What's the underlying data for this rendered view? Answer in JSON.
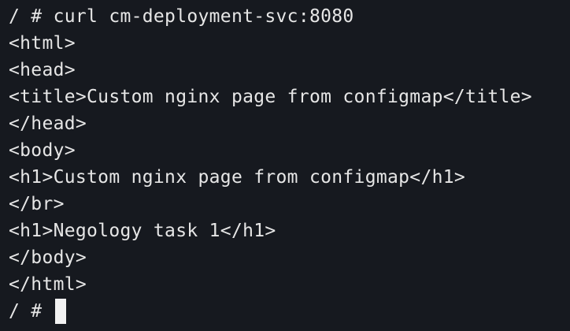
{
  "terminal": {
    "lines": [
      "/ # curl cm-deployment-svc:8080",
      "<html>",
      "<head>",
      "<title>Custom nginx page from configmap</title>",
      "</head>",
      "<body>",
      "<h1>Custom nginx page from configmap</h1>",
      "</br>",
      "<h1>Negology task 1</h1>",
      "</body>",
      "</html>"
    ],
    "prompt": "/ # ",
    "colors": {
      "background": "#16191f",
      "foreground": "#e6e6e6",
      "cursor": "#f2f2f2"
    }
  }
}
